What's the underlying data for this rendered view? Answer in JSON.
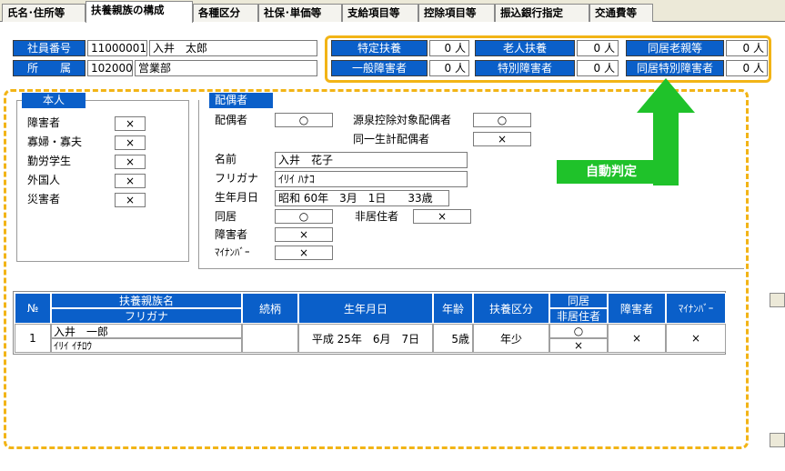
{
  "tabs": [
    "氏名･住所等",
    "扶養親族の構成",
    "各種区分",
    "社保･単価等",
    "支給項目等",
    "控除項目等",
    "振込銀行指定",
    "交通費等"
  ],
  "header": {
    "emp_no_label": "社員番号",
    "emp_no": "11000001",
    "emp_name": "入井　太郎",
    "dept_label": "所　　属",
    "dept_code": "102000",
    "dept_name": "営業部"
  },
  "counts": {
    "tokutei_label": "特定扶養",
    "tokutei": "0 人",
    "rojin_label": "老人扶養",
    "rojin": "0 人",
    "doukyo_rojin_label": "同居老親等",
    "doukyo_rojin": "0 人",
    "ippan_label": "一般障害者",
    "ippan": "0 人",
    "tokubetsu_label": "特別障害者",
    "tokubetsu": "0 人",
    "doukyo_toku_label": "同居特別障害者",
    "doukyo_toku": "0 人"
  },
  "honnin": {
    "title": "本人",
    "rows": [
      {
        "label": "障害者",
        "value": "×"
      },
      {
        "label": "寡婦・寡夫",
        "value": "×"
      },
      {
        "label": "勤労学生",
        "value": "×"
      },
      {
        "label": "外国人",
        "value": "×"
      },
      {
        "label": "災害者",
        "value": "×"
      }
    ]
  },
  "spouse": {
    "title": "配偶者",
    "haigusha_label": "配偶者",
    "haigusha": "○",
    "gensen_label": "源泉控除対象配偶者",
    "gensen": "○",
    "seikei_label": "同一生計配偶者",
    "seikei": "×",
    "name_label": "名前",
    "name": "入井　花子",
    "kana_label": "フリガナ",
    "kana": "ｲﾘｲ ﾊﾅｺ",
    "dob_label": "生年月日",
    "dob": "昭和 60年　3月　1日　　33歳",
    "doukyo_label": "同居",
    "doukyo": "○",
    "hikyoju_label": "非居住者",
    "hikyoju": "×",
    "shogai_label": "障害者",
    "shogai": "×",
    "mynumber_label": "ﾏｲﾅﾝﾊﾞｰ",
    "mynumber": "×"
  },
  "auto": {
    "label": "自動判定"
  },
  "table": {
    "h_no": "№",
    "h_name": "扶養親族名",
    "h_kana": "フリガナ",
    "h_rel": "続柄",
    "h_dob": "生年月日",
    "h_age": "年齢",
    "h_kubun": "扶養区分",
    "h_doukyo": "同居",
    "h_hikyoju": "非居住者",
    "h_shogai": "障害者",
    "h_mynum": "ﾏｲﾅﾝﾊﾞｰ",
    "rows": [
      {
        "no": "1",
        "name": "入井　一郎",
        "kana": "ｲﾘｲ ｲﾁﾛｳ",
        "rel": "",
        "dob": "平成 25年　6月　7日",
        "age": "5歳",
        "kubun": "年少",
        "doukyo": "○",
        "hikyoju": "×",
        "shogai": "×",
        "mynum": "×"
      }
    ]
  },
  "colors": {
    "accent": "#0a5fc9",
    "highlight": "#f2b416",
    "arrow": "#1fc22a"
  }
}
